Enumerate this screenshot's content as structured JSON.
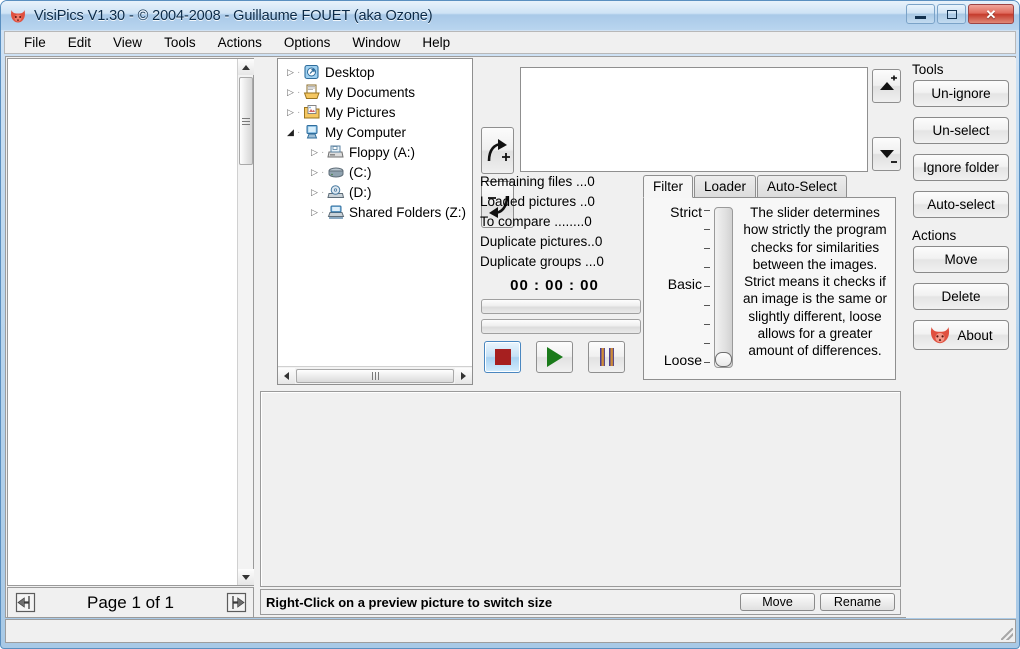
{
  "window": {
    "title": "VisiPics V1.30 - © 2004-2008 - Guillaume FOUET (aka Ozone)",
    "app_icon": "fox-icon",
    "minimize_label": "Minimize",
    "maximize_label": "Maximize",
    "close_label": "Close"
  },
  "menubar": {
    "items": [
      {
        "label": "File"
      },
      {
        "label": "Edit"
      },
      {
        "label": "View"
      },
      {
        "label": "Tools"
      },
      {
        "label": "Actions"
      },
      {
        "label": "Options"
      },
      {
        "label": "Window"
      },
      {
        "label": "Help"
      }
    ]
  },
  "tree": {
    "nodes": [
      {
        "label": "Desktop",
        "icon": "desktop-icon",
        "indent": 0,
        "expander": "collapsed"
      },
      {
        "label": "My Documents",
        "icon": "documents-icon",
        "indent": 0,
        "expander": "collapsed"
      },
      {
        "label": "My Pictures",
        "icon": "pictures-icon",
        "indent": 0,
        "expander": "collapsed"
      },
      {
        "label": "My Computer",
        "icon": "computer-icon",
        "indent": 0,
        "expander": "expanded"
      },
      {
        "label": "Floppy (A:)",
        "icon": "floppy-drive-icon",
        "indent": 1,
        "expander": "collapsed"
      },
      {
        "label": "(C:)",
        "icon": "hard-drive-icon",
        "indent": 1,
        "expander": "collapsed"
      },
      {
        "label": "(D:)",
        "icon": "cd-drive-icon",
        "indent": 1,
        "expander": "collapsed"
      },
      {
        "label": "Shared Folders (Z:)",
        "icon": "network-drive-icon",
        "indent": 1,
        "expander": "collapsed"
      }
    ]
  },
  "folder_controls": {
    "add_label": "add-folder",
    "remove_label": "remove-folder",
    "move_up_label": "move-up",
    "move_down_label": "move-down",
    "list_items": []
  },
  "counters": {
    "rows": [
      {
        "label": "Remaining files ...",
        "value": "0"
      },
      {
        "label": "Loaded pictures ..",
        "value": "0"
      },
      {
        "label": "To compare ........",
        "value": "0"
      },
      {
        "label": "Duplicate pictures..",
        "value": "0"
      },
      {
        "label": "Duplicate groups ...",
        "value": "0"
      }
    ],
    "timer": "00 : 00 : 00",
    "progress_1": 0,
    "progress_2": 0
  },
  "transport": {
    "stop_label": "Stop",
    "play_label": "Play",
    "pause_label": "Pause"
  },
  "tabs": {
    "items": [
      {
        "label": "Filter",
        "active": true
      },
      {
        "label": "Loader",
        "active": false
      },
      {
        "label": "Auto-Select",
        "active": false
      }
    ]
  },
  "filter": {
    "top_label": "Strict",
    "mid_label": "Basic",
    "bottom_label": "Loose",
    "slider_position": "Loose",
    "tick_count": 9,
    "description": "The slider determines how strictly the program checks for similarities between the images. Strict means it checks if an image is the same or slightly different, loose allows for a greater amount of differences."
  },
  "tools": {
    "group_label": "Tools",
    "buttons": [
      {
        "label": "Un-ignore"
      },
      {
        "label": "Un-select"
      },
      {
        "label": "Ignore folder"
      },
      {
        "label": "Auto-select"
      }
    ]
  },
  "actions": {
    "group_label": "Actions",
    "buttons": [
      {
        "label": "Move"
      },
      {
        "label": "Delete"
      }
    ],
    "about_label": "About",
    "about_icon": "fox-icon"
  },
  "pagination": {
    "label": "Page 1 of 1",
    "prev_icon": "previous-page-icon",
    "next_icon": "next-page-icon"
  },
  "statusbar": {
    "text": "Right-Click on a preview picture to switch size",
    "move_label": "Move",
    "rename_label": "Rename"
  },
  "colors": {
    "titlebar_accent": "#a9c9e8",
    "close_button": "#c43b2c",
    "stop_icon": "#a61f1f",
    "play_icon": "#1a7a1a",
    "pause_icon": "#2a2aa8",
    "fox_icon": "#d94a3d"
  }
}
